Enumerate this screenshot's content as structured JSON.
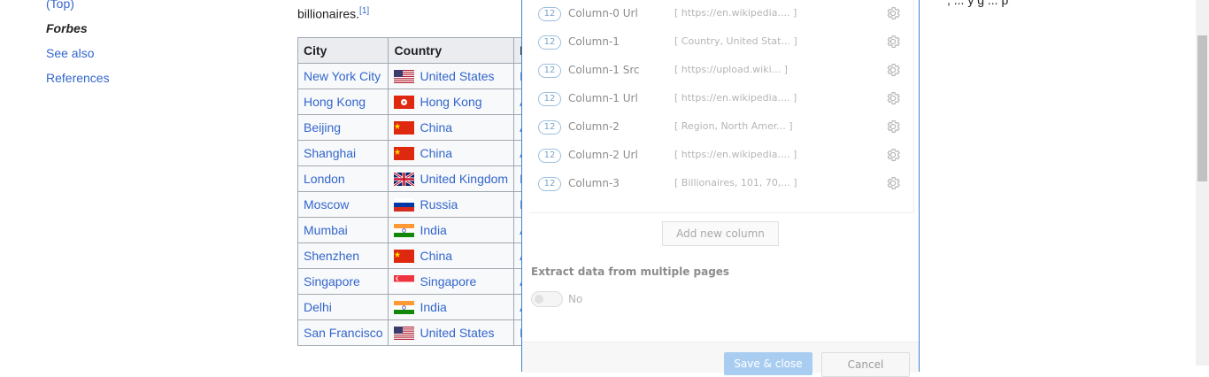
{
  "toc": {
    "items": [
      {
        "label": "(Top)",
        "active": false
      },
      {
        "label": "Forbes",
        "active": true
      },
      {
        "label": "See also",
        "active": false
      },
      {
        "label": "References",
        "active": false
      }
    ]
  },
  "intro": {
    "text": "billionaires.",
    "ref": "[1]"
  },
  "table": {
    "headers": [
      "City",
      "Country",
      "F"
    ],
    "rows": [
      {
        "city": "New York City",
        "country": "United States",
        "flag": "us",
        "partial": "N"
      },
      {
        "city": "Hong Kong",
        "country": "Hong Kong",
        "flag": "hk",
        "partial": "A"
      },
      {
        "city": "Beijing",
        "country": "China",
        "flag": "cn",
        "partial": "A"
      },
      {
        "city": "Shanghai",
        "country": "China",
        "flag": "cn",
        "partial": "A"
      },
      {
        "city": "London",
        "country": "United Kingdom",
        "flag": "uk",
        "partial": "E"
      },
      {
        "city": "Moscow",
        "country": "Russia",
        "flag": "ru",
        "partial": "E"
      },
      {
        "city": "Mumbai",
        "country": "India",
        "flag": "in",
        "partial": "A"
      },
      {
        "city": "Shenzhen",
        "country": "China",
        "flag": "cn",
        "partial": "A"
      },
      {
        "city": "Singapore",
        "country": "Singapore",
        "flag": "sg",
        "partial": "A"
      },
      {
        "city": "Delhi",
        "country": "India",
        "flag": "in",
        "partial": "A"
      },
      {
        "city": "San Francisco",
        "country": "United States",
        "flag": "us",
        "partial": "N"
      }
    ]
  },
  "right_text": ", ... y g ... p",
  "modal": {
    "columns": [
      {
        "badge": "12",
        "name": "Column-0 Url",
        "sample": "[ https://en.wikipedia.... ]"
      },
      {
        "badge": "12",
        "name": "Column-1",
        "sample": "[ Country, United Stat... ]"
      },
      {
        "badge": "12",
        "name": "Column-1 Src",
        "sample": "[ https://upload.wiki... ]"
      },
      {
        "badge": "12",
        "name": "Column-1 Url",
        "sample": "[ https://en.wikipedia.... ]"
      },
      {
        "badge": "12",
        "name": "Column-2",
        "sample": "[ Region, North Amer... ]"
      },
      {
        "badge": "12",
        "name": "Column-2 Url",
        "sample": "[ https://en.wikipedia.... ]"
      },
      {
        "badge": "12",
        "name": "Column-3",
        "sample": "[ Billionaires, 101, 70,... ]"
      }
    ],
    "add_column_label": "Add new column",
    "multi_page_label": "Extract data from multiple pages",
    "toggle_label": "No",
    "toggle_on": false,
    "save_label": "Save & close",
    "cancel_label": "Cancel"
  },
  "icons": {
    "settings": "gear-icon"
  },
  "colors": {
    "link": "#3366cc",
    "accent": "#3f86ce"
  }
}
